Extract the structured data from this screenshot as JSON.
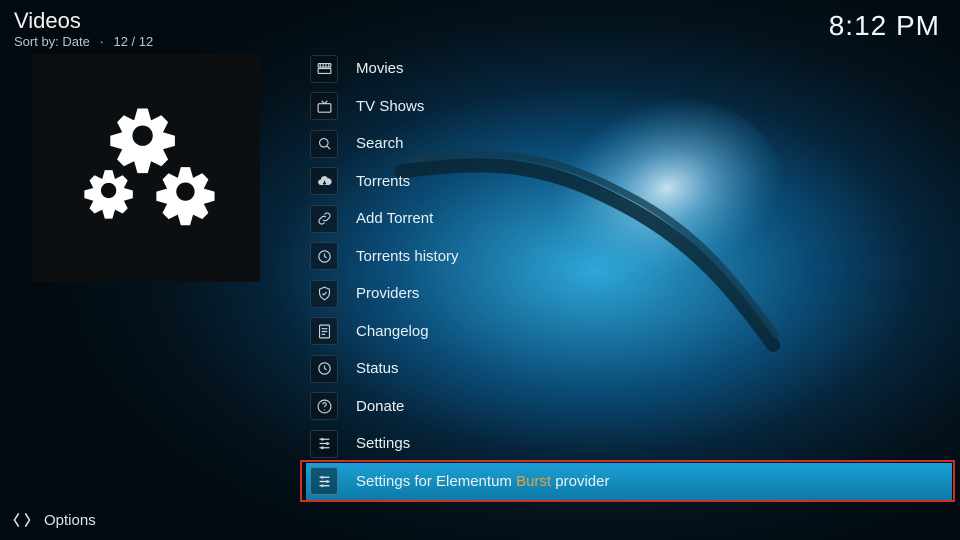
{
  "header": {
    "title": "Videos",
    "sort_label": "Sort by:",
    "sort_value": "Date",
    "count": "12 / 12"
  },
  "clock": "8:12 PM",
  "list": {
    "items": [
      {
        "icon": "movies-icon",
        "label": "Movies"
      },
      {
        "icon": "tv-icon",
        "label": "TV Shows"
      },
      {
        "icon": "search-icon",
        "label": "Search"
      },
      {
        "icon": "cloud-down-icon",
        "label": "Torrents"
      },
      {
        "icon": "link-icon",
        "label": "Add Torrent"
      },
      {
        "icon": "history-icon",
        "label": "Torrents history"
      },
      {
        "icon": "shield-icon",
        "label": "Providers"
      },
      {
        "icon": "doc-icon",
        "label": "Changelog"
      },
      {
        "icon": "history-icon",
        "label": "Status"
      },
      {
        "icon": "help-icon",
        "label": "Donate"
      },
      {
        "icon": "sliders-icon",
        "label": "Settings"
      },
      {
        "icon": "sliders-icon",
        "label_prefix": "Settings for Elementum ",
        "label_accent": "Burst",
        "label_suffix": " provider",
        "selected": true
      }
    ]
  },
  "footer": {
    "options_label": "Options"
  }
}
